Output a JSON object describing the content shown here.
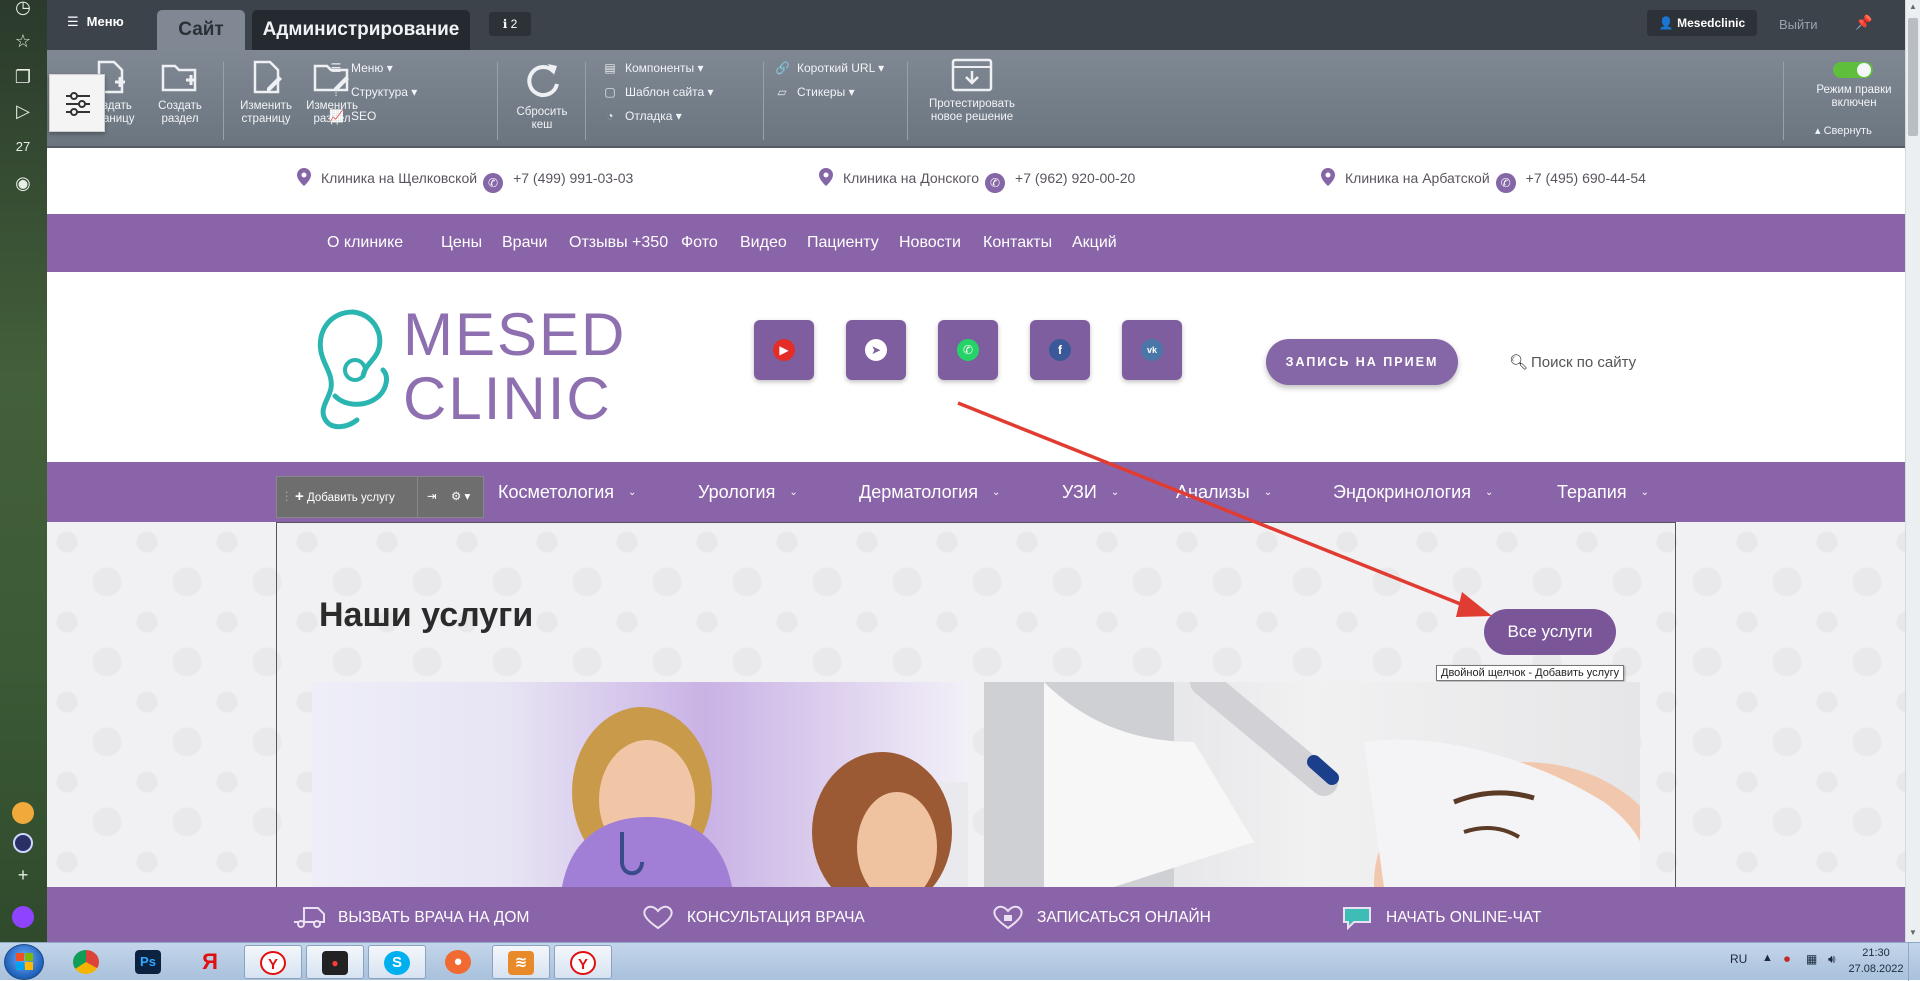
{
  "admin": {
    "menu_label": "Меню",
    "tab_site": "Сайт",
    "tab_admin": "Администрирование",
    "notifications_count": "2",
    "user": "Mesedclinic",
    "logout": "Выйти",
    "tools": {
      "create_page": "Создать страницу",
      "create_section": "Создать раздел",
      "edit_page": "Изменить страницу",
      "edit_section": "Изменить раздел",
      "menu": "Меню",
      "structure": "Структура",
      "seo": "SEO",
      "reset_cache": "Сбросить кеш",
      "components": "Компоненты",
      "site_template": "Шаблон сайта",
      "debug": "Отладка",
      "short_url": "Короткий URL",
      "stickers": "Стикеры",
      "test_solution": "Протестировать новое решение",
      "edit_mode": "Режим правки включен",
      "collapse": "Свернуть"
    }
  },
  "contacts": [
    {
      "clinic": "Клиника на Щелковской",
      "phone": "+7 (499) 991-03-03"
    },
    {
      "clinic": "Клиника на Донского",
      "phone": "+7 (962) 920-00-20"
    },
    {
      "clinic": "Клиника на Арбатской",
      "phone": "+7 (495) 690-44-54"
    }
  ],
  "topnav": [
    "О клинике",
    "Цены",
    "Врачи",
    "Отзывы +350",
    "Фото",
    "Видео",
    "Пациенту",
    "Новости",
    "Контакты",
    "Акций"
  ],
  "logo": {
    "line1": "MESED",
    "line2": "CLINIC"
  },
  "social": [
    "youtube-icon",
    "telegram-icon",
    "whatsapp-icon",
    "facebook-icon",
    "vk-icon"
  ],
  "appointment_button": "ЗАПИСЬ НА ПРИЕМ",
  "search_placeholder": "Поиск по сайту",
  "editor": {
    "add_service": "Добавить услугу"
  },
  "categories": [
    "Косметология",
    "Урология",
    "Дерматология",
    "УЗИ",
    "Анализы",
    "Эндокринология",
    "Терапия"
  ],
  "services": {
    "heading": "Наши услуги",
    "all_button": "Все услуги",
    "tooltip": "Двойной щелчок - Добавить услугу"
  },
  "bottom_bar": [
    "ВЫЗВАТЬ ВРАЧА НА ДОМ",
    "КОНСУЛЬТАЦИЯ ВРАЧА",
    "ЗАПИСАТЬСЯ ОНЛАЙН",
    "НАЧАТЬ ONLINE-ЧАТ"
  ],
  "taskbar": {
    "lang": "RU",
    "time": "21:30",
    "date": "27.08.2022"
  },
  "colors": {
    "brand_purple": "#8a64a8",
    "admin_dark": "#3c434b",
    "admin_toolbar": "#757e89",
    "annotation_arrow": "#e03c31"
  }
}
